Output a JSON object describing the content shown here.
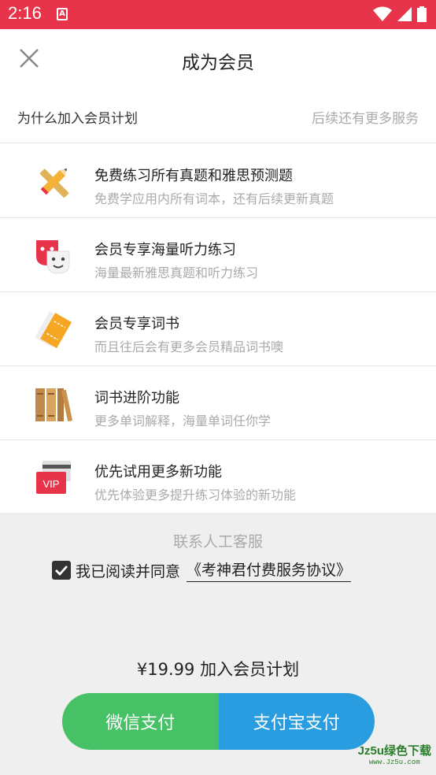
{
  "status_bar": {
    "time": "2:16",
    "app_badge": "A",
    "background": "#e8344a"
  },
  "header": {
    "title": "成为会员"
  },
  "intro": {
    "left": "为什么加入会员计划",
    "right": "后续还有更多服务"
  },
  "benefits": [
    {
      "title": "免费练习所有真题和雅思预测题",
      "desc": "免费学应用内所有词本，还有后续更新真题",
      "icon": "pencil-ruler-icon"
    },
    {
      "title": "会员专享海量听力练习",
      "desc": "海量最新雅思真题和听力练习",
      "icon": "theater-masks-icon"
    },
    {
      "title": "会员专享词书",
      "desc": "而且往后会有更多会员精品词书噢",
      "icon": "ticket-icon"
    },
    {
      "title": "词书进阶功能",
      "desc": "更多单词解释，海量单词任你学",
      "icon": "books-icon"
    },
    {
      "title": "优先试用更多新功能",
      "desc": "优先体验更多提升练习体验的新功能",
      "icon": "vip-card-icon"
    }
  ],
  "bottom": {
    "contact": "联系人工客服",
    "agree_text": "我已阅读并同意",
    "agreement_link": "《考神君付费服务协议》",
    "agreed": true,
    "price_text": "¥19.99 加入会员计划",
    "wechat_pay": "微信支付",
    "alipay_pay": "支付宝支付",
    "wechat_color": "#46c165",
    "alipay_color": "#2a9ce0"
  },
  "watermark": {
    "main": "Jz5u绿色下载",
    "sub": "www.Jz5u.com"
  }
}
